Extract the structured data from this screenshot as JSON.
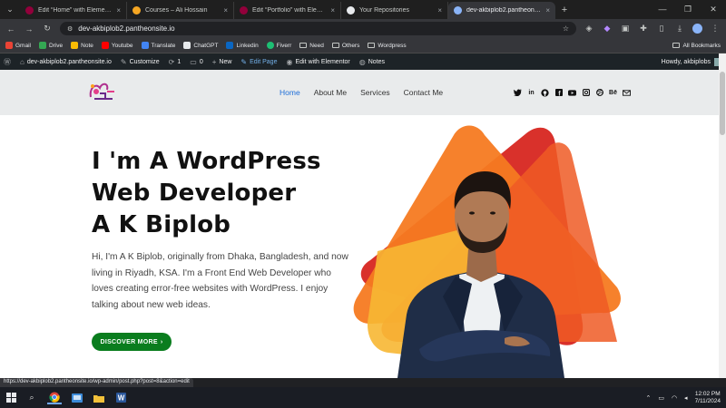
{
  "browser": {
    "tabs": [
      {
        "title": "Edit “Home” with Elementor",
        "color": "#92003b",
        "active": false
      },
      {
        "title": "Courses – Ali Hossain",
        "color": "#f5a623",
        "active": false
      },
      {
        "title": "Edit “Portfolio” with Elementor",
        "color": "#92003b",
        "active": false
      },
      {
        "title": "Your Repositories",
        "color": "#e8eaed",
        "active": false
      },
      {
        "title": "dev-akbiplob2.pantheonsite.io",
        "color": "#8ab4f8",
        "active": true
      }
    ],
    "new_tab": "+",
    "address": "dev-akbiplob2.pantheonsite.io",
    "bookmarks": [
      {
        "label": "Gmail",
        "color": "#ea4335",
        "folder": false
      },
      {
        "label": "Drive",
        "color": "#34a853",
        "folder": false
      },
      {
        "label": "Note",
        "color": "#fbbc04",
        "folder": false
      },
      {
        "label": "Youtube",
        "color": "#ff0000",
        "folder": false
      },
      {
        "label": "Translate",
        "color": "#4285f4",
        "folder": false
      },
      {
        "label": "ChatGPT",
        "color": "#e8eaed",
        "folder": false
      },
      {
        "label": "Linkedin",
        "color": "#0a66c2",
        "folder": false
      },
      {
        "label": "Fiverr",
        "color": "#1dbf73",
        "folder": false
      },
      {
        "label": "Need",
        "color": "",
        "folder": true
      },
      {
        "label": "Others",
        "color": "",
        "folder": true
      },
      {
        "label": "Wordpress",
        "color": "",
        "folder": true
      }
    ],
    "all_bookmarks": "All Bookmarks",
    "status_url": "https://dev-akbiplob2.pantheonsite.io/wp-admin/post.php?post=8&action=edit"
  },
  "wpbar": {
    "site": "dev-akbiplob2.pantheonsite.io",
    "customize": "Customize",
    "updates": "1",
    "comments": "0",
    "new": "New",
    "edit_page": "Edit Page",
    "elementor": "Edit with Elementor",
    "notes": "Notes",
    "howdy": "Howdy, akbiplobs"
  },
  "site": {
    "nav": [
      "Home",
      "About Me",
      "Services",
      "Contact Me"
    ],
    "social_icons": [
      "twitter-icon",
      "linkedin-icon",
      "github-icon",
      "facebook-icon",
      "youtube-icon",
      "instagram-icon",
      "dribbble-icon",
      "behance-icon",
      "email-icon"
    ],
    "behance_label": "Bē"
  },
  "hero": {
    "line1": "I 'm A WordPress",
    "line2": "Web Developer",
    "line3": "A K Biplob",
    "bio": "Hi, I'm A K Biplob, originally from Dhaka, Bangladesh, and now living in Riyadh, KSA. I'm a Front End Web Developer who loves creating error-free websites with WordPress. I enjoy talking about new web ideas.",
    "cta": "DISCOVER MORE",
    "cta_arrow": "›"
  },
  "taskbar": {
    "time": "12:02 PM",
    "date": "7/11/2024"
  },
  "colors": {
    "accent_nav": "#1f6fd8",
    "cta": "#0a7d1e",
    "wpbar": "#1d2327"
  }
}
